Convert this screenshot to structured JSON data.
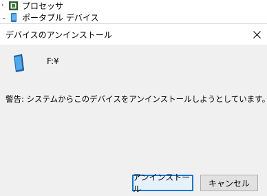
{
  "tree": {
    "items": [
      {
        "label": "プロセッサ",
        "icon": "processor-icon"
      },
      {
        "label": "ポータブル デバイス",
        "icon": "portable-device-icon"
      }
    ]
  },
  "dialog": {
    "title": "デバイスのアンインストール",
    "device_name": "F:¥",
    "device_icon": "portable-device-icon",
    "warning": "警告: システムからこのデバイスをアンインストールしようとしています。",
    "uninstall_label": "アンインストール",
    "cancel_label": "キャンセル"
  },
  "colors": {
    "accent": "#0078d7",
    "dialog_bg": "#f0f0f0"
  }
}
